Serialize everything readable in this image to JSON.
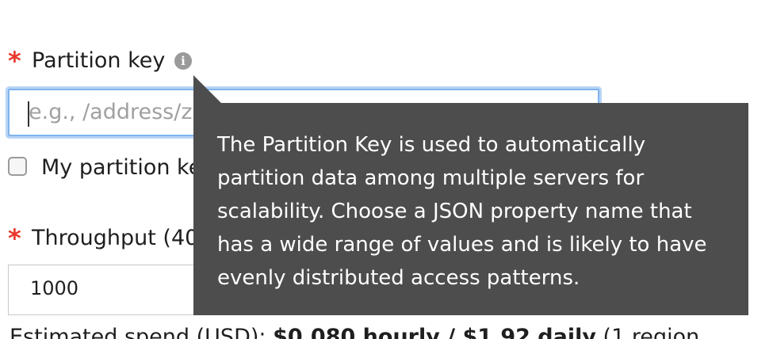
{
  "form": {
    "partition_key": {
      "required_mark": "*",
      "label": "Partition key",
      "info_icon": "info-circle-icon",
      "placeholder": "e.g., /address/z"
    },
    "checkbox": {
      "label": "My partition ke"
    },
    "throughput": {
      "required_mark": "*",
      "label": "Throughput (40",
      "value": "1000"
    },
    "estimated_spend": {
      "prefix": "Estimated spend (USD): ",
      "amount": "$0.080 hourly / $1.92 daily",
      "suffix": " (1 region"
    }
  },
  "tooltip": {
    "text": "The Partition Key is used to automatically partition data among multiple servers for scalability. Choose a JSON property name that has a wide range of values and is likely to have evenly distributed access patterns."
  },
  "colors": {
    "required": "#e8372c",
    "tooltip_bg": "#4d4d4d",
    "focus_border": "#7fb4ec"
  }
}
